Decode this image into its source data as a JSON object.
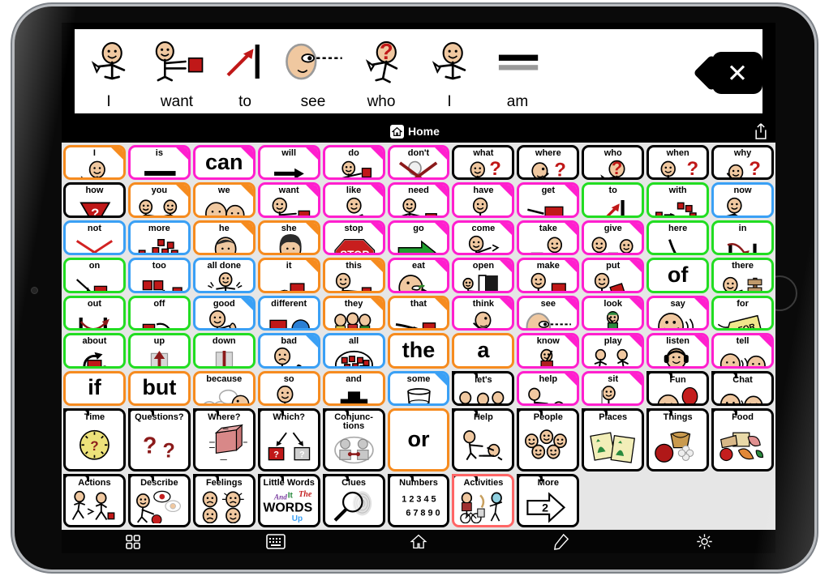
{
  "app": {
    "nav": {
      "home_label": "Home",
      "home_icon": "home-icon",
      "share_icon": "share-icon"
    },
    "clear_button": {
      "icon": "close-x-icon",
      "label": "×"
    }
  },
  "sentence_bar": {
    "words": [
      {
        "word": "I",
        "art": "person-pointing-self"
      },
      {
        "word": "want",
        "art": "person-reaching-red-square"
      },
      {
        "word": "to",
        "art": "red-arrow-to-bar"
      },
      {
        "word": "see",
        "art": "face-eye-dashes"
      },
      {
        "word": "who",
        "art": "person-question-head"
      },
      {
        "word": "I",
        "art": "person-pointing-self"
      },
      {
        "word": "am",
        "art": "equals-bars"
      }
    ]
  },
  "colors": {
    "pronoun_orange": "#F68B1F",
    "verb_magenta": "#FF1FCE",
    "preposition_green": "#22DD22",
    "adverb_blue": "#3AA0F5",
    "question_black": "#000000",
    "selected_red": "#FF6666",
    "background_gray": "#E6E6E6"
  },
  "grid": {
    "rows": 7,
    "cols": 11,
    "cells": [
      {
        "label": "I",
        "border": "#F68B1F",
        "flag": "#F68B1F",
        "art": "person-pointing-self",
        "kind": "word"
      },
      {
        "label": "is",
        "border": "#FF1FCE",
        "flag": "#FF1FCE",
        "art": "equals-bars",
        "kind": "word"
      },
      {
        "label": "can",
        "border": "#FF1FCE",
        "flag": "#FF1FCE",
        "art": "can",
        "kind": "text"
      },
      {
        "label": "will",
        "border": "#FF1FCE",
        "flag": "#FF1FCE",
        "art": "arrow-right-bar",
        "kind": "word"
      },
      {
        "label": "do",
        "border": "#FF1FCE",
        "flag": "#FF1FCE",
        "art": "person-action",
        "kind": "word"
      },
      {
        "label": "don't",
        "border": "#FF1FCE",
        "flag": "#FF1FCE",
        "art": "person-crossed-out",
        "kind": "word"
      },
      {
        "label": "what",
        "border": "#000000",
        "flag": null,
        "art": "person-shrug-question",
        "kind": "word"
      },
      {
        "label": "where",
        "border": "#000000",
        "flag": null,
        "art": "person-looking-question",
        "kind": "word"
      },
      {
        "label": "who",
        "border": "#000000",
        "flag": null,
        "art": "person-question-head",
        "kind": "word"
      },
      {
        "label": "when",
        "border": "#000000",
        "flag": null,
        "art": "person-clock-question",
        "kind": "word"
      },
      {
        "label": "why",
        "border": "#000000",
        "flag": null,
        "art": "person-thinking-question",
        "kind": "word"
      },
      {
        "label": "how",
        "border": "#000000",
        "flag": null,
        "art": "triangle-question",
        "kind": "word"
      },
      {
        "label": "you",
        "border": "#F68B1F",
        "flag": "#F68B1F",
        "art": "two-people-pointing",
        "kind": "word"
      },
      {
        "label": "we",
        "border": "#F68B1F",
        "flag": "#F68B1F",
        "art": "two-faces",
        "kind": "word"
      },
      {
        "label": "want",
        "border": "#FF1FCE",
        "flag": "#FF1FCE",
        "art": "person-reaching-red-square",
        "kind": "word"
      },
      {
        "label": "like",
        "border": "#FF1FCE",
        "flag": "#FF1FCE",
        "art": "person-hugging-red",
        "kind": "word"
      },
      {
        "label": "need",
        "border": "#FF1FCE",
        "flag": "#FF1FCE",
        "art": "person-need-red",
        "kind": "word"
      },
      {
        "label": "have",
        "border": "#FF1FCE",
        "flag": "#FF1FCE",
        "art": "person-holding-red",
        "kind": "word"
      },
      {
        "label": "get",
        "border": "#FF1FCE",
        "flag": "#FF1FCE",
        "art": "hands-red-square",
        "kind": "word"
      },
      {
        "label": "to",
        "border": "#22DD22",
        "flag": null,
        "art": "red-arrow-to-bar",
        "kind": "word"
      },
      {
        "label": "with",
        "border": "#22DD22",
        "flag": null,
        "art": "squares-joining",
        "kind": "word"
      },
      {
        "label": "now",
        "border": "#3AA0F5",
        "flag": null,
        "art": "person-with-clock",
        "kind": "word"
      },
      {
        "label": "not",
        "border": "#3AA0F5",
        "flag": null,
        "art": "red-x",
        "kind": "word"
      },
      {
        "label": "more",
        "border": "#3AA0F5",
        "flag": null,
        "art": "many-red-squares-arrow",
        "kind": "word"
      },
      {
        "label": "he",
        "border": "#F68B1F",
        "flag": "#F68B1F",
        "art": "boy-face-arrow",
        "kind": "word"
      },
      {
        "label": "she",
        "border": "#F68B1F",
        "flag": "#F68B1F",
        "art": "girl-face-arrow",
        "kind": "word"
      },
      {
        "label": "stop",
        "border": "#FF1FCE",
        "flag": "#FF1FCE",
        "art": "stop-sign",
        "kind": "word"
      },
      {
        "label": "go",
        "border": "#FF1FCE",
        "flag": "#FF1FCE",
        "art": "green-arrow",
        "kind": "word"
      },
      {
        "label": "come",
        "border": "#FF1FCE",
        "flag": "#FF1FCE",
        "art": "person-beckoning",
        "kind": "word"
      },
      {
        "label": "take",
        "border": "#FF1FCE",
        "flag": "#FF1FCE",
        "art": "person-taking-red",
        "kind": "word"
      },
      {
        "label": "give",
        "border": "#FF1FCE",
        "flag": "#FF1FCE",
        "art": "two-people-giving-red",
        "kind": "word"
      },
      {
        "label": "here",
        "border": "#22DD22",
        "flag": null,
        "art": "hand-pointing-mat",
        "kind": "word"
      },
      {
        "label": "in",
        "border": "#22DD22",
        "flag": null,
        "art": "arrow-into-container",
        "kind": "word"
      },
      {
        "label": "on",
        "border": "#22DD22",
        "flag": null,
        "art": "square-on-line",
        "kind": "word"
      },
      {
        "label": "too",
        "border": "#3AA0F5",
        "flag": null,
        "art": "squares-plus-one",
        "kind": "word"
      },
      {
        "label": "all done",
        "border": "#3AA0F5",
        "flag": null,
        "art": "person-empty-plate",
        "kind": "word"
      },
      {
        "label": "it",
        "border": "#F68B1F",
        "flag": "#F68B1F",
        "art": "hand-pointing-red-square",
        "kind": "word"
      },
      {
        "label": "this",
        "border": "#F68B1F",
        "flag": "#F68B1F",
        "art": "person-pointing-red-square",
        "kind": "word"
      },
      {
        "label": "eat",
        "border": "#FF1FCE",
        "flag": "#FF1FCE",
        "art": "face-eating-fork",
        "kind": "word"
      },
      {
        "label": "open",
        "border": "#FF1FCE",
        "flag": "#FF1FCE",
        "art": "person-opening-door",
        "kind": "word"
      },
      {
        "label": "make",
        "border": "#FF1FCE",
        "flag": "#FF1FCE",
        "art": "person-making-red",
        "kind": "word"
      },
      {
        "label": "put",
        "border": "#FF1FCE",
        "flag": "#FF1FCE",
        "art": "person-putting-red",
        "kind": "word"
      },
      {
        "label": "of",
        "border": "#22DD22",
        "flag": null,
        "art": "of",
        "kind": "text"
      },
      {
        "label": "there",
        "border": "#22DD22",
        "flag": null,
        "art": "person-pointing-signpost",
        "kind": "word"
      },
      {
        "label": "out",
        "border": "#22DD22",
        "flag": null,
        "art": "arrow-out-container",
        "kind": "word"
      },
      {
        "label": "off",
        "border": "#22DD22",
        "flag": null,
        "art": "square-off-line",
        "kind": "word"
      },
      {
        "label": "good",
        "border": "#3AA0F5",
        "flag": "#3AA0F5",
        "art": "person-thumbs-up",
        "kind": "word"
      },
      {
        "label": "different",
        "border": "#3AA0F5",
        "flag": null,
        "art": "red-square-blue-circle",
        "kind": "word"
      },
      {
        "label": "they",
        "border": "#F68B1F",
        "flag": "#F68B1F",
        "art": "group-people-arrow",
        "kind": "word"
      },
      {
        "label": "that",
        "border": "#F68B1F",
        "flag": "#F68B1F",
        "art": "hand-pointing-far-square",
        "kind": "word"
      },
      {
        "label": "think",
        "border": "#FF1FCE",
        "flag": "#FF1FCE",
        "art": "person-thinking",
        "kind": "word"
      },
      {
        "label": "see",
        "border": "#FF1FCE",
        "flag": "#FF1FCE",
        "art": "face-eye-dashes",
        "kind": "word"
      },
      {
        "label": "look",
        "border": "#FF1FCE",
        "flag": "#FF1FCE",
        "art": "person-looking-up",
        "kind": "word"
      },
      {
        "label": "say",
        "border": "#FF1FCE",
        "flag": "#FF1FCE",
        "art": "face-speaking",
        "kind": "word"
      },
      {
        "label": "for",
        "border": "#22DD22",
        "flag": null,
        "art": "gift-tag-for",
        "kind": "word"
      },
      {
        "label": "about",
        "border": "#22DD22",
        "flag": null,
        "art": "circle-arrow-red-square",
        "kind": "word"
      },
      {
        "label": "up",
        "border": "#22DD22",
        "flag": null,
        "art": "up-arrow-box",
        "kind": "word"
      },
      {
        "label": "down",
        "border": "#22DD22",
        "flag": null,
        "art": "down-arrow-box",
        "kind": "word"
      },
      {
        "label": "bad",
        "border": "#3AA0F5",
        "flag": "#3AA0F5",
        "art": "person-thumbs-down",
        "kind": "word"
      },
      {
        "label": "all",
        "border": "#3AA0F5",
        "flag": null,
        "art": "circle-full-squares",
        "kind": "word"
      },
      {
        "label": "the",
        "border": "#F68B1F",
        "flag": null,
        "art": "the",
        "kind": "text"
      },
      {
        "label": "a",
        "border": "#F68B1F",
        "flag": null,
        "art": "a",
        "kind": "text"
      },
      {
        "label": "know",
        "border": "#FF1FCE",
        "flag": "#FF1FCE",
        "art": "person-raising-hand-desk",
        "kind": "word"
      },
      {
        "label": "play",
        "border": "#FF1FCE",
        "flag": "#FF1FCE",
        "art": "two-people-running",
        "kind": "word"
      },
      {
        "label": "listen",
        "border": "#FF1FCE",
        "flag": "#FF1FCE",
        "art": "person-headphones",
        "kind": "word"
      },
      {
        "label": "tell",
        "border": "#FF1FCE",
        "flag": "#FF1FCE",
        "art": "two-faces-talking",
        "kind": "word"
      },
      {
        "label": "if",
        "border": "#F68B1F",
        "flag": null,
        "art": "if",
        "kind": "text"
      },
      {
        "label": "but",
        "border": "#F68B1F",
        "flag": null,
        "art": "but",
        "kind": "text"
      },
      {
        "label": "because",
        "border": "#F68B1F",
        "flag": null,
        "art": "faces-speech-question",
        "kind": "word"
      },
      {
        "label": "so",
        "border": "#F68B1F",
        "flag": null,
        "art": "person-gesturing",
        "kind": "word"
      },
      {
        "label": "and",
        "border": "#F68B1F",
        "flag": null,
        "art": "black-plus",
        "kind": "word"
      },
      {
        "label": "some",
        "border": "#3AA0F5",
        "flag": "#3AA0F5",
        "art": "glass-half-full",
        "kind": "word"
      },
      {
        "label": "let's",
        "border": "#000000",
        "flag": null,
        "art": "people-group-red",
        "kind": "folder"
      },
      {
        "label": "help",
        "border": "#FF1FCE",
        "flag": "#FF1FCE",
        "art": "person-helping-up",
        "kind": "word"
      },
      {
        "label": "sit",
        "border": "#FF1FCE",
        "flag": "#FF1FCE",
        "art": "person-on-chair",
        "kind": "word"
      },
      {
        "label": "Fun",
        "border": "#000000",
        "flag": null,
        "art": "face-balloon",
        "kind": "folder"
      },
      {
        "label": "Chat",
        "border": "#000000",
        "flag": null,
        "art": "two-faces-chat",
        "kind": "folder"
      },
      {
        "label": "Time",
        "border": "#000000",
        "flag": null,
        "art": "clock-question",
        "kind": "folder"
      },
      {
        "label": "Questions?",
        "border": "#000000",
        "flag": null,
        "art": "two-question-marks",
        "kind": "folder"
      },
      {
        "label": "Where?",
        "border": "#000000",
        "flag": null,
        "art": "labeled-box",
        "kind": "folder"
      },
      {
        "label": "Which?",
        "border": "#000000",
        "flag": null,
        "art": "two-arrows-two-boxes",
        "kind": "folder"
      },
      {
        "label": "Conjunc-\ntions",
        "border": "#000000",
        "flag": null,
        "art": "two-figures-linked",
        "kind": "folder"
      },
      {
        "label": "or",
        "border": "#F68B1F",
        "flag": null,
        "art": "or",
        "kind": "text"
      },
      {
        "label": "Help",
        "border": "#000000",
        "flag": null,
        "art": "person-helping-up",
        "kind": "folder"
      },
      {
        "label": "People",
        "border": "#000000",
        "flag": null,
        "art": "many-faces",
        "kind": "folder"
      },
      {
        "label": "Places",
        "border": "#000000",
        "flag": null,
        "art": "two-maps",
        "kind": "folder"
      },
      {
        "label": "Things",
        "border": "#000000",
        "flag": null,
        "art": "ball-basket-toy",
        "kind": "folder"
      },
      {
        "label": "Food",
        "border": "#000000",
        "flag": null,
        "art": "assorted-food",
        "kind": "folder"
      },
      {
        "label": "Actions",
        "border": "#000000",
        "flag": null,
        "art": "people-moving",
        "kind": "folder"
      },
      {
        "label": "Describe",
        "border": "#000000",
        "flag": null,
        "art": "person-describing-apple",
        "kind": "folder"
      },
      {
        "label": "Feelings",
        "border": "#000000",
        "flag": null,
        "art": "four-emotion-faces",
        "kind": "folder"
      },
      {
        "label": "Little Words",
        "border": "#000000",
        "flag": null,
        "art": "words-collage",
        "kind": "folder"
      },
      {
        "label": "Clues",
        "border": "#000000",
        "flag": null,
        "art": "magnifier-fingerprint",
        "kind": "folder"
      },
      {
        "label": "Numbers",
        "border": "#000000",
        "flag": null,
        "art": "numbers-1234567890",
        "kind": "folder"
      },
      {
        "label": "Activities",
        "border": "#FF6666",
        "flag": null,
        "art": "people-activities",
        "kind": "folder"
      },
      {
        "label": "More",
        "border": "#000000",
        "flag": null,
        "art": "arrow-page-2",
        "kind": "folder"
      }
    ]
  },
  "toolbar": {
    "buttons": [
      {
        "name": "grid-view-button",
        "icon": "grid-icon"
      },
      {
        "name": "keyboard-button",
        "icon": "keyboard-icon"
      },
      {
        "name": "home-button",
        "icon": "home-icon"
      },
      {
        "name": "edit-button",
        "icon": "pencil-icon"
      },
      {
        "name": "settings-button",
        "icon": "gear-icon"
      }
    ]
  }
}
